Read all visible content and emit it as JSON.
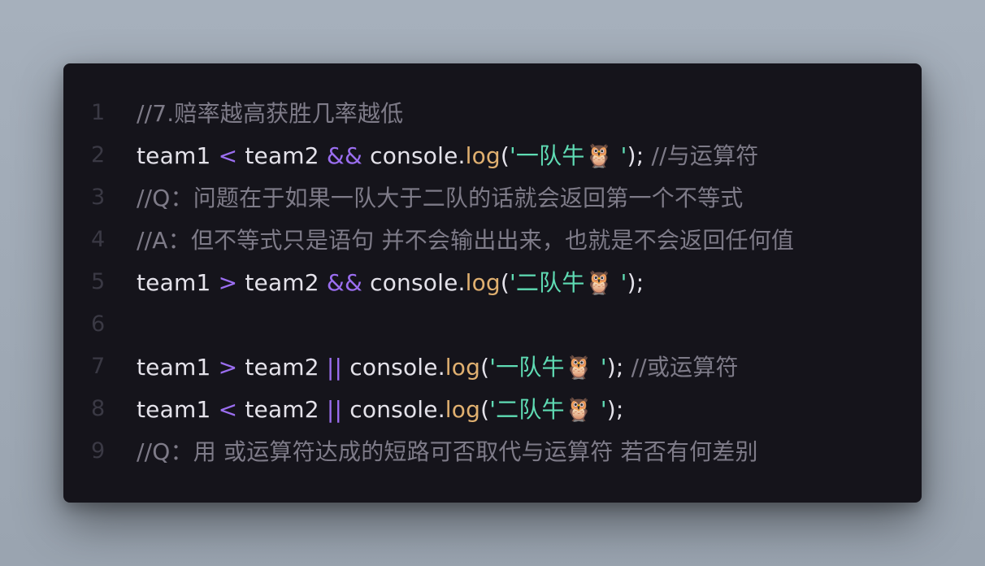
{
  "editor": {
    "lines": [
      {
        "num": "1",
        "comment": "//7.赔率越高获胜几率越低"
      },
      {
        "num": "2",
        "left": "team1",
        "cmp": "<",
        "right": "team2",
        "logic": "&&",
        "obj": "console.",
        "fn": "log",
        "open": "(",
        "str": "'一队牛🦉 '",
        "close": ");",
        "comment": " //与运算符"
      },
      {
        "num": "3",
        "comment": "//Q：问题在于如果一队大于二队的话就会返回第一个不等式"
      },
      {
        "num": "4",
        "comment": "//A：但不等式只是语句 并不会输出出来，也就是不会返回任何值"
      },
      {
        "num": "5",
        "left": "team1",
        "cmp": ">",
        "right": "team2",
        "logic": "&&",
        "obj": "console.",
        "fn": "log",
        "open": "(",
        "str": "'二队牛🦉 '",
        "close": ");"
      },
      {
        "num": "6"
      },
      {
        "num": "7",
        "left": "team1",
        "cmp": ">",
        "right": "team2",
        "logic": "||",
        "obj": "console.",
        "fn": "log",
        "open": "(",
        "str": "'一队牛🦉 '",
        "close": ");",
        "comment": " //或运算符"
      },
      {
        "num": "8",
        "left": "team1",
        "cmp": "<",
        "right": "team2",
        "logic": "||",
        "obj": "console.",
        "fn": "log",
        "open": "(",
        "str": "'二队牛🦉 '",
        "close": ");"
      },
      {
        "num": "9",
        "comment": "//Q：用 或运算符达成的短路可否取代与运算符 若否有何差别"
      }
    ]
  },
  "colors": {
    "background": "#15141b",
    "comment": "#7e7b88",
    "operator": "#9b6ef0",
    "function": "#e0b070",
    "string": "#5fdcb4",
    "text": "#e4e2ea",
    "line_number": "#3a3944"
  }
}
